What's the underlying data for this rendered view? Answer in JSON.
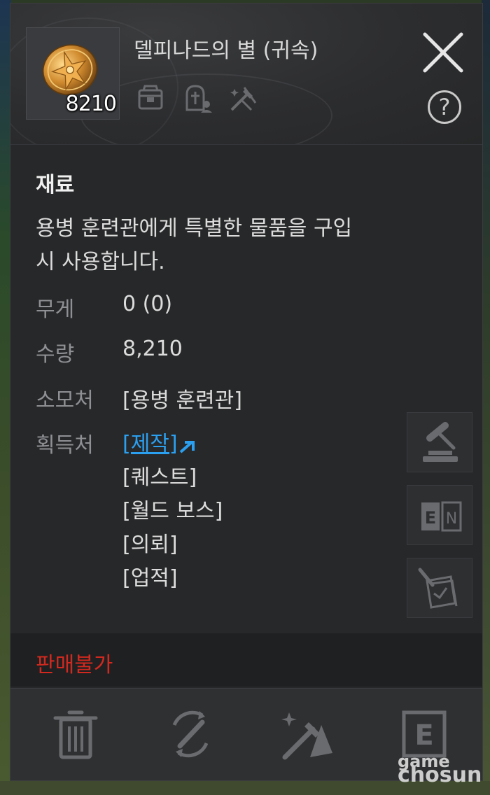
{
  "item": {
    "name": "델피나드의 별 (귀속)",
    "count": "8210",
    "category": "재료",
    "description_line1": "용병 훈련관에게 특별한 물품을 구입",
    "description_line2": "시 사용합니다."
  },
  "header_icons": [
    "storage-icon",
    "grave-icon",
    "crafting-icon"
  ],
  "stats": {
    "weight_label": "무게",
    "weight_value": "0 (0)",
    "quantity_label": "수량",
    "quantity_value": "8,210",
    "consume_label": "소모처",
    "consume_value": "[용병 훈련관]",
    "source_label": "획득처",
    "sources": [
      "[제작]",
      "[퀘스트]",
      "[월드 보스]",
      "[의뢰]",
      "[업적]"
    ]
  },
  "side_buttons": [
    "auction-icon",
    "encyclopedia-icon",
    "quest-log-icon"
  ],
  "side_labels": {
    "encyclopedia_left": "E",
    "encyclopedia_right": "N"
  },
  "sell_status": "판매불가",
  "footer_buttons": [
    "trash-icon",
    "dismantle-icon",
    "craft-icon",
    "equip-e-icon"
  ],
  "footer_labels": {
    "equip": "E"
  },
  "watermark": {
    "line1": "game",
    "line2": "chosun"
  },
  "colors": {
    "link": "#2b9ff0",
    "no_sell": "#d1291f",
    "panel_bg": "#272829"
  }
}
